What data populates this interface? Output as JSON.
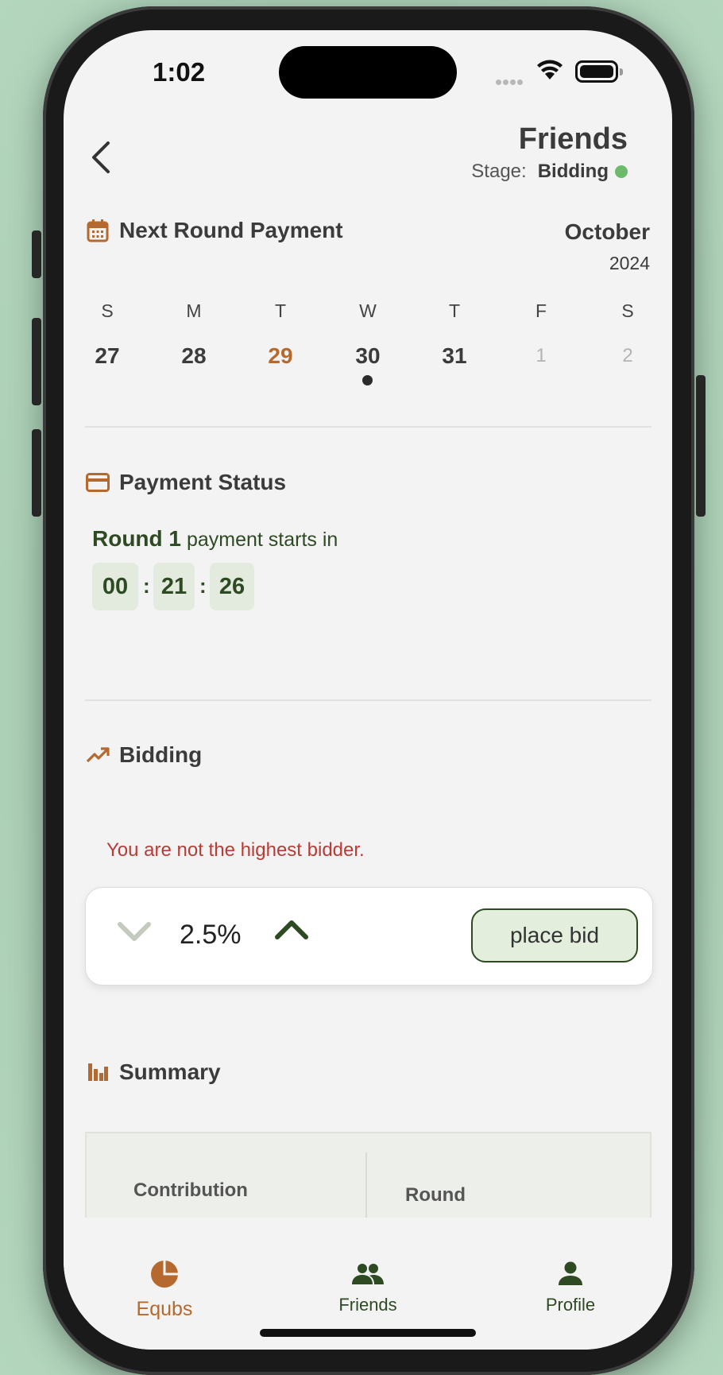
{
  "status_bar": {
    "time": "1:02"
  },
  "header": {
    "title": "Friends",
    "stage_label": "Stage:",
    "stage_value": "Bidding"
  },
  "next_round": {
    "title": "Next Round Payment",
    "month": "October",
    "year": "2024",
    "weekdays": [
      "S",
      "M",
      "T",
      "W",
      "T",
      "F",
      "S"
    ],
    "days": [
      "27",
      "28",
      "29",
      "30",
      "31",
      "1",
      "2"
    ]
  },
  "payment_status": {
    "title": "Payment Status",
    "round_label": "Round 1",
    "starts_in": "payment starts in",
    "countdown": {
      "hours": "00",
      "minutes": "21",
      "seconds": "26"
    }
  },
  "bidding": {
    "title": "Bidding",
    "error": "You are not the highest bidder.",
    "value": "2.5%",
    "place_bid_label": "place bid"
  },
  "summary": {
    "title": "Summary",
    "col_1_label": "Contribution",
    "col_2_label": "Round"
  },
  "tabbar": {
    "tabs": [
      {
        "label": "Equbs",
        "icon": "pie-chart-icon",
        "active": true
      },
      {
        "label": "Friends",
        "icon": "group-icon",
        "active": false
      },
      {
        "label": "Profile",
        "icon": "person-icon",
        "active": false
      }
    ]
  },
  "colors": {
    "accent": "#b5692e",
    "primary_green": "#2e4a23",
    "error": "#b83c36",
    "stage_dot": "#6dbb6a",
    "countdown_bg": "#e2ebdd"
  }
}
